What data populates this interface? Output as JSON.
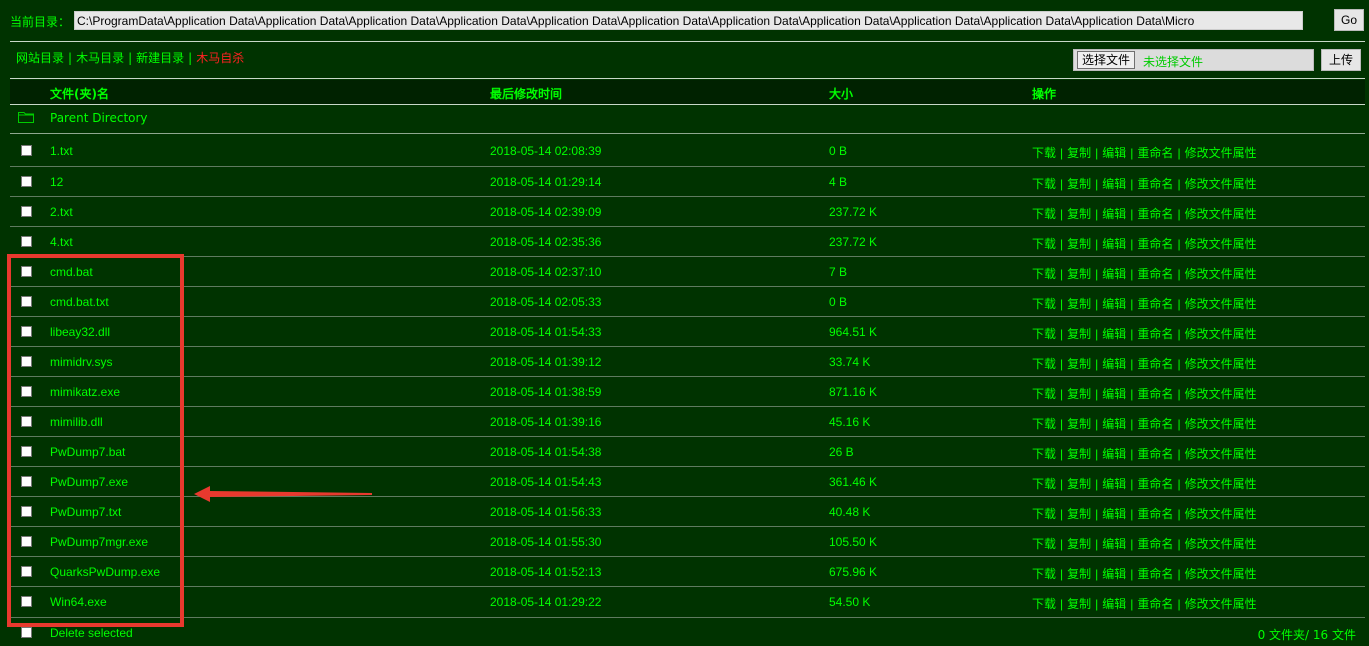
{
  "topbar": {
    "path_label": "当前目录：",
    "path_value": "C:\\ProgramData\\Application Data\\Application Data\\Application Data\\Application Data\\Application Data\\Application Data\\Application Data\\Application Data\\Application Data\\Application Data\\Application Data\\Micro",
    "go_label": "Go"
  },
  "nav": {
    "items": [
      "网站目录",
      "木马目录",
      "新建目录",
      "木马自杀"
    ]
  },
  "upload": {
    "choose_label": "选择文件",
    "no_file_label": "未选择文件",
    "upload_label": "上传"
  },
  "table": {
    "headers": {
      "name": "文件(夹)名",
      "mtime": "最后修改时间",
      "size": "大小",
      "ops": "操作"
    },
    "parent_label": "Parent Directory",
    "op_labels": [
      "下载",
      "复制",
      "编辑",
      "重命名",
      "修改文件属性"
    ],
    "rows": [
      {
        "name": "1.txt",
        "mtime": "2018-05-14 02:08:39",
        "size": "0 B"
      },
      {
        "name": "12",
        "mtime": "2018-05-14 01:29:14",
        "size": "4 B"
      },
      {
        "name": "2.txt",
        "mtime": "2018-05-14 02:39:09",
        "size": "237.72 K"
      },
      {
        "name": "4.txt",
        "mtime": "2018-05-14 02:35:36",
        "size": "237.72 K"
      },
      {
        "name": "cmd.bat",
        "mtime": "2018-05-14 02:37:10",
        "size": "7 B"
      },
      {
        "name": "cmd.bat.txt",
        "mtime": "2018-05-14 02:05:33",
        "size": "0 B"
      },
      {
        "name": "libeay32.dll",
        "mtime": "2018-05-14 01:54:33",
        "size": "964.51 K"
      },
      {
        "name": "mimidrv.sys",
        "mtime": "2018-05-14 01:39:12",
        "size": "33.74 K"
      },
      {
        "name": "mimikatz.exe",
        "mtime": "2018-05-14 01:38:59",
        "size": "871.16 K"
      },
      {
        "name": "mimilib.dll",
        "mtime": "2018-05-14 01:39:16",
        "size": "45.16 K"
      },
      {
        "name": "PwDump7.bat",
        "mtime": "2018-05-14 01:54:38",
        "size": "26 B"
      },
      {
        "name": "PwDump7.exe",
        "mtime": "2018-05-14 01:54:43",
        "size": "361.46 K"
      },
      {
        "name": "PwDump7.txt",
        "mtime": "2018-05-14 01:56:33",
        "size": "40.48 K"
      },
      {
        "name": "PwDump7mgr.exe",
        "mtime": "2018-05-14 01:55:30",
        "size": "105.50 K"
      },
      {
        "name": "QuarksPwDump.exe",
        "mtime": "2018-05-14 01:52:13",
        "size": "675.96 K"
      },
      {
        "name": "Win64.exe",
        "mtime": "2018-05-14 01:29:22",
        "size": "54.50 K"
      }
    ]
  },
  "footer": {
    "delete_label": "Delete selected",
    "count_label": "0 文件夹/ 16 文件"
  },
  "colors": {
    "background": "#003300",
    "text": "#00ff00",
    "danger": "#ff2222",
    "annotation": "#e8392e"
  }
}
